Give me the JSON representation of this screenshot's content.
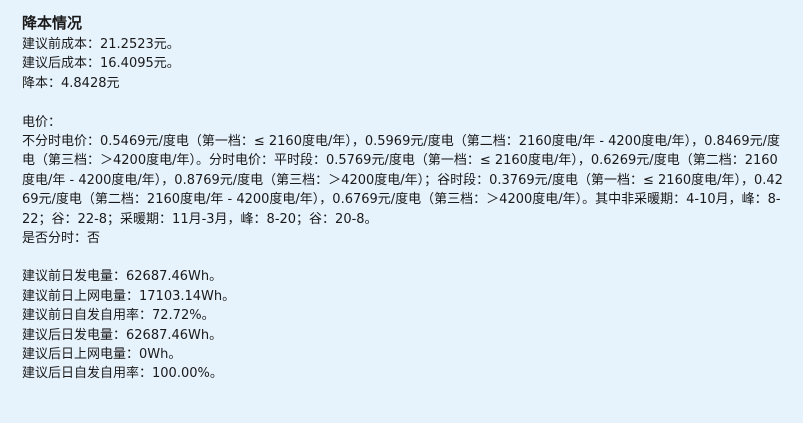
{
  "title": "降本情况",
  "cost": {
    "before": "建议前成本：21.2523元。",
    "after": "建议后成本：16.4095元。",
    "reduction": "降本：4.8428元"
  },
  "price": {
    "label": "电价：",
    "detail": "不分时电价：0.5469元/度电（第一档：≤ 2160度电/年），0.5969元/度电（第二档：2160度电/年 - 4200度电/年），0.8469元/度电（第三档：＞4200度电/年）。分时电价：平时段：0.5769元/度电（第一档：≤ 2160度电/年），0.6269元/度电（第二档：2160度电/年 - 4200度电/年），0.8769元/度电（第三档：＞4200度电/年）；谷时段：0.3769元/度电（第一档：≤ 2160度电/年），0.4269元/度电（第二档：2160度电/年 - 4200度电/年），0.6769元/度电（第三档：＞4200度电/年）。其中非采暖期：4-10月，峰：8-22；谷：22-8；采暖期：11月-3月，峰：8-20；谷：20-8。",
    "time_of_use": "是否分时：否"
  },
  "energy": {
    "before_generation": "建议前日发电量：62687.46Wh。",
    "before_grid": "建议前日上网电量：17103.14Wh。",
    "before_self_use": "建议前日自发自用率：72.72%。",
    "after_generation": "建议后日发电量：62687.46Wh。",
    "after_grid": "建议后日上网电量：0Wh。",
    "after_self_use": "建议后日自发自用率：100.00%。"
  }
}
